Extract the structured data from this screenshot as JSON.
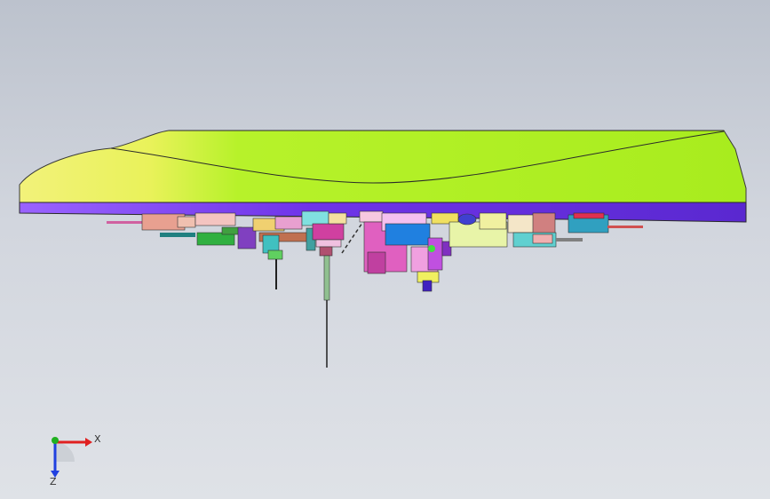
{
  "viewport": {
    "background_top": "#bcc2cd",
    "background_bottom": "#dfe2e7"
  },
  "model": {
    "plate_top_color": "#a8f020",
    "plate_bottom_color": "#7a3cf0",
    "left_sweep_color": "#e8f060"
  },
  "triad": {
    "x_label": "X",
    "z_label": "Z",
    "x_color": "#e02020",
    "y_color": "#20b020",
    "z_color": "#2040e0"
  }
}
